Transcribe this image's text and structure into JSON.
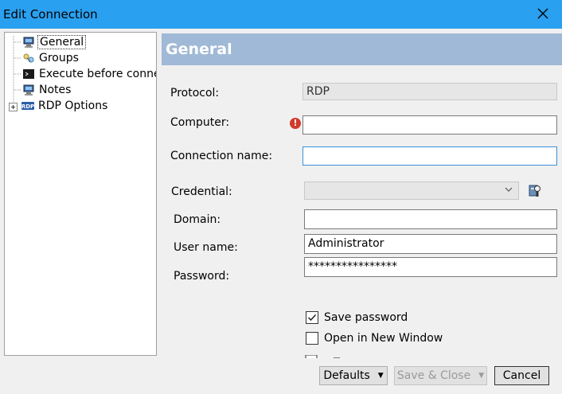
{
  "window": {
    "title": "Edit Connection"
  },
  "tree": {
    "items": [
      {
        "label": "General",
        "icon": "computer-icon",
        "selected": true
      },
      {
        "label": "Groups",
        "icon": "groups-icon"
      },
      {
        "label": "Execute before connect",
        "icon": "terminal-icon"
      },
      {
        "label": "Notes",
        "icon": "notes-icon"
      },
      {
        "label": "RDP Options",
        "icon": "rdp-icon",
        "expander": "+"
      }
    ]
  },
  "panel": {
    "header": "General",
    "protocol": {
      "label": "Protocol:",
      "value": "RDP"
    },
    "computer": {
      "label": "Computer:",
      "value": ""
    },
    "connection_name": {
      "label": "Connection name:",
      "value": ""
    },
    "credential": {
      "label": "Credential:",
      "value": ""
    },
    "domain": {
      "label": "Domain:",
      "value": ""
    },
    "username": {
      "label": "User name:",
      "value": "Administrator"
    },
    "password": {
      "label": "Password:",
      "value": "****************"
    },
    "save_password": {
      "label": "Save password",
      "checked": true
    },
    "open_new_window": {
      "label": "Open in New Window",
      "checked": false
    }
  },
  "buttons": {
    "defaults": "Defaults",
    "save_close": "Save & Close",
    "cancel": "Cancel"
  },
  "colors": {
    "titlebar": "#2aa0f0",
    "panel_header": "#a0b9d6",
    "error": "#d23a2a"
  }
}
